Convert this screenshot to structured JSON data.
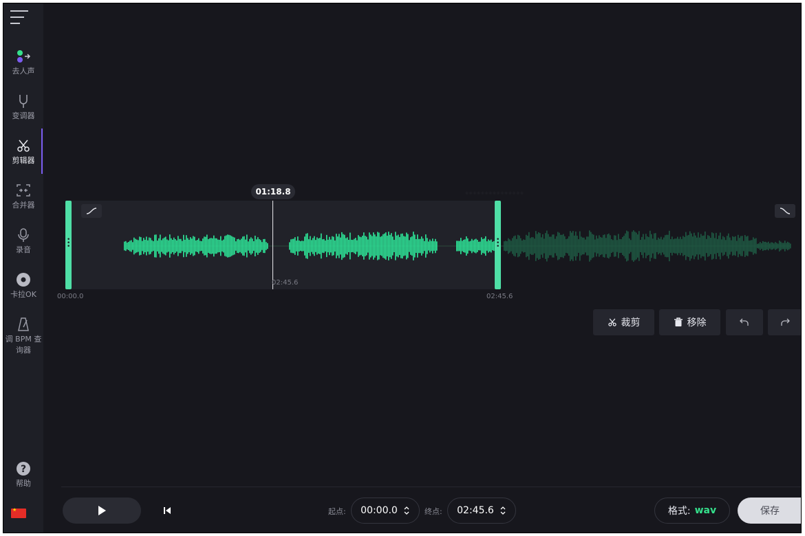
{
  "sidebar": {
    "items": [
      {
        "label": "去人声",
        "icon": "vocal-remover-icon",
        "active": false
      },
      {
        "label": "变调器",
        "icon": "tuning-fork-icon",
        "active": false
      },
      {
        "label": "剪辑器",
        "icon": "scissors-icon",
        "active": true
      },
      {
        "label": "合并器",
        "icon": "merge-icon",
        "active": false
      },
      {
        "label": "录音",
        "icon": "microphone-icon",
        "active": false
      },
      {
        "label": "卡拉OK",
        "icon": "disc-icon",
        "active": false
      },
      {
        "label": "调 BPM 查",
        "label2": "询器",
        "icon": "metronome-icon",
        "active": false
      }
    ],
    "help_label": "帮助",
    "language_flag": "cn-flag-icon"
  },
  "editor": {
    "playhead_time": "01:18.8",
    "playhead_sub_time": "02:45.6",
    "start_time_label": "00:00.0",
    "end_time_label": "02:45.6",
    "blurred_info": "· · · · · · · · · · · · · · ·",
    "trim_label": "裁剪",
    "remove_label": "移除"
  },
  "colors": {
    "accent": "#7b5cf0",
    "wave_selected": "#2ee89a",
    "wave_unselected": "#1e5a43",
    "handle": "#4fdfa6",
    "format_value": "#35e08c"
  },
  "footer": {
    "start_label": "起点:",
    "start_value": "00:00.0",
    "end_label": "终点:",
    "end_value": "02:45.6",
    "format_label": "格式:",
    "format_value": "wav",
    "save_label": "保存"
  }
}
